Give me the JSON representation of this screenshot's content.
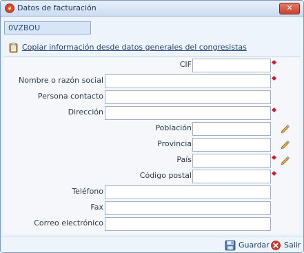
{
  "window": {
    "title": "Datos de facturación",
    "close_label": "✕"
  },
  "code": {
    "value": "0VZBOU"
  },
  "copy_link": {
    "label": "Copiar información desde datos generales del congresistas"
  },
  "fields": [
    {
      "label": "CIF",
      "value": "",
      "required": true,
      "editable_icon": false
    },
    {
      "label": "Nombre o razón social",
      "value": "",
      "required": true,
      "editable_icon": false
    },
    {
      "label": "Persona contacto",
      "value": "",
      "required": false,
      "editable_icon": false
    },
    {
      "label": "Dirección",
      "value": "",
      "required": true,
      "editable_icon": false
    },
    {
      "label": "Población",
      "value": "",
      "required": false,
      "editable_icon": true
    },
    {
      "label": "Provincia",
      "value": "",
      "required": false,
      "editable_icon": true
    },
    {
      "label": "País",
      "value": "",
      "required": true,
      "editable_icon": true
    },
    {
      "label": "Código postal",
      "value": "",
      "required": true,
      "editable_icon": false
    },
    {
      "label": "Teléfono",
      "value": "",
      "required": false,
      "editable_icon": false
    },
    {
      "label": "Fax",
      "value": "",
      "required": false,
      "editable_icon": false
    },
    {
      "label": "Correo electrónico",
      "value": "",
      "required": false,
      "editable_icon": false
    }
  ],
  "footer": {
    "save_label": "Guardar",
    "exit_label": "Salir"
  },
  "colors": {
    "required_marker": "#d7192f",
    "title_gradient_top": "#e7f0fb",
    "title_gradient_bottom": "#cddcf0"
  },
  "icons": {
    "app": "app-flame-icon",
    "copy": "clipboard-icon",
    "edit": "pencil-icon",
    "save": "floppy-disk-icon",
    "exit": "exit-icon"
  }
}
